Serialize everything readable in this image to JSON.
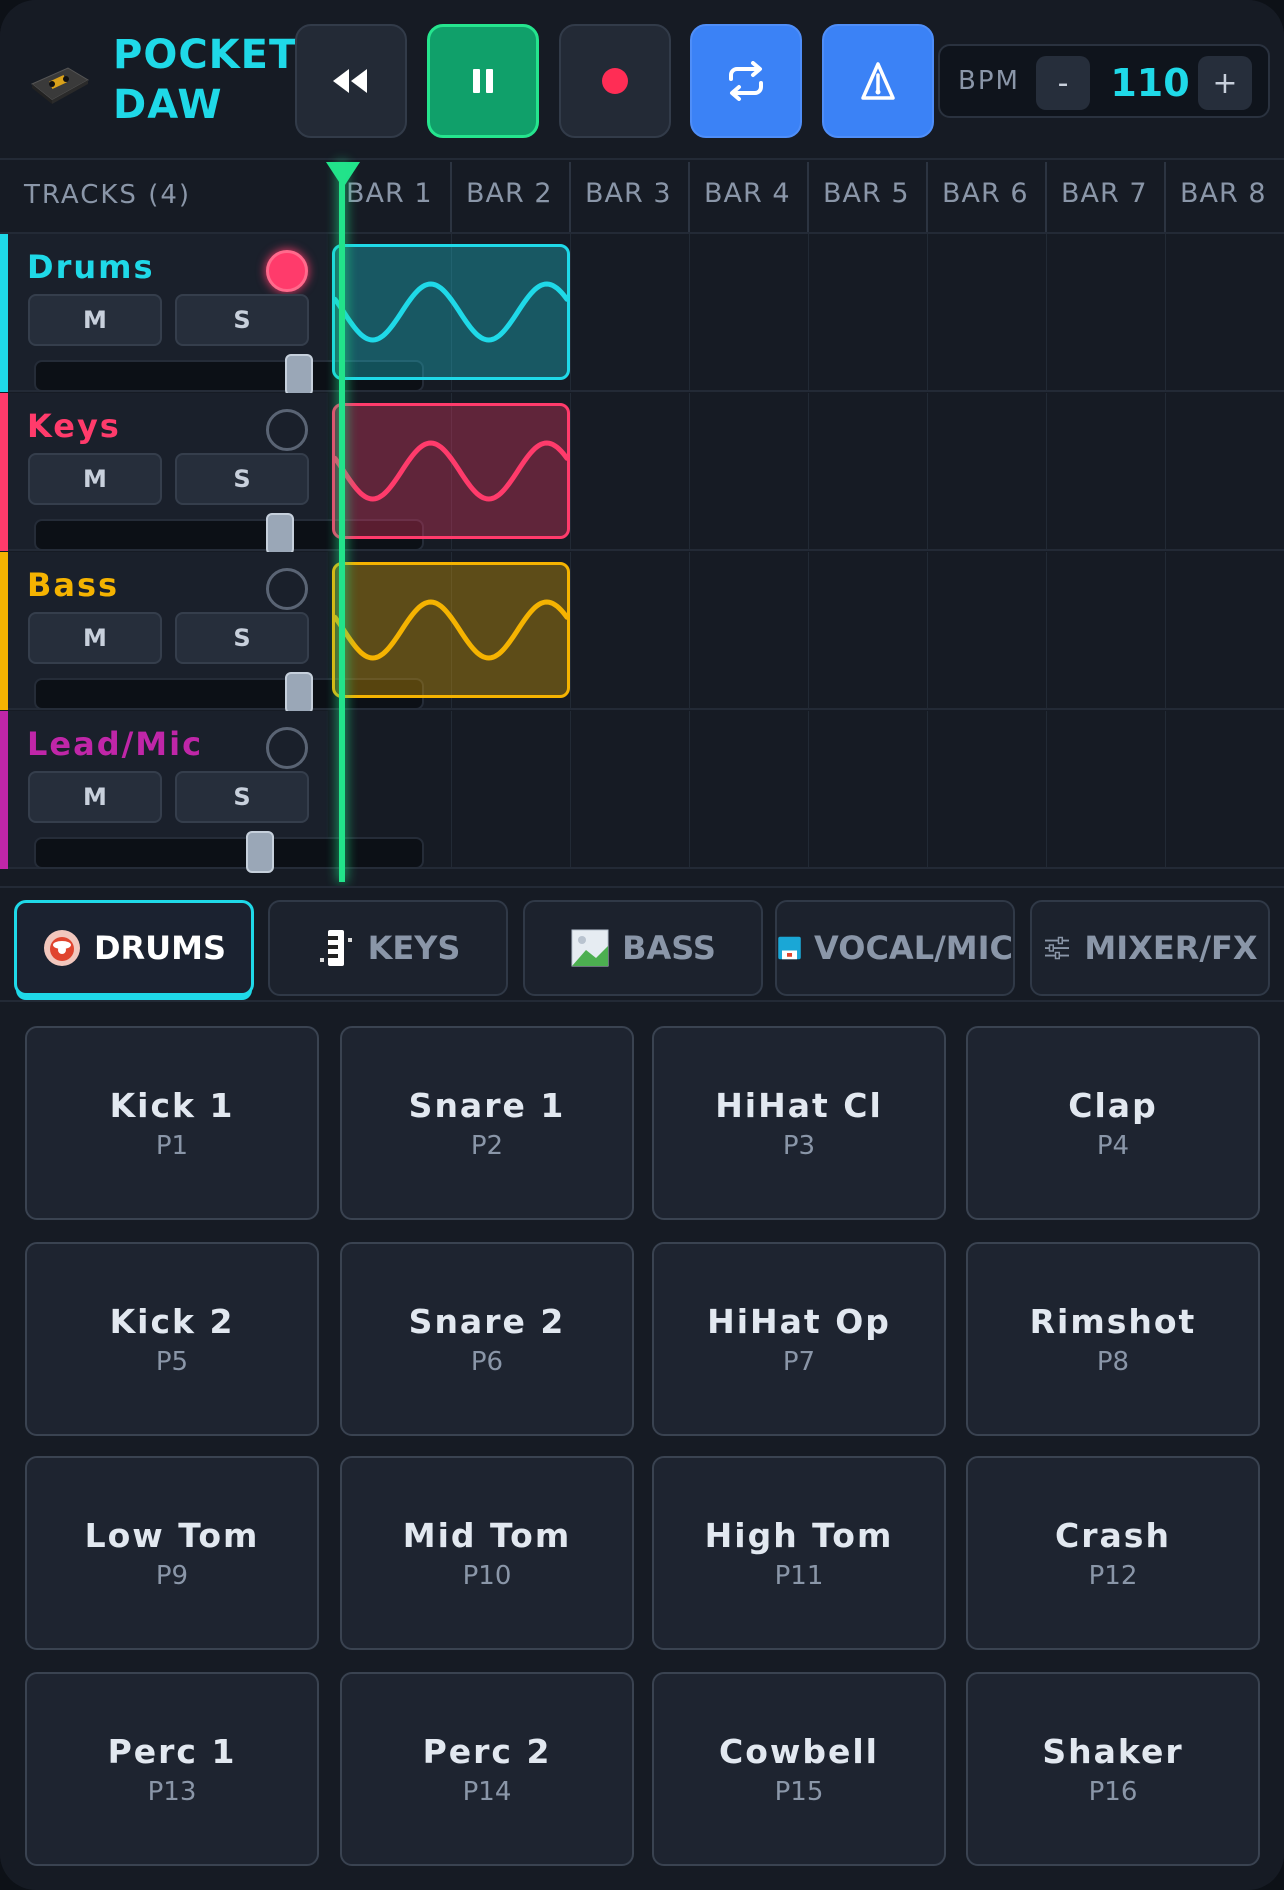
{
  "app": {
    "title_line1": "POCKET",
    "title_line2": "DAW"
  },
  "transport": {
    "rewind_icon": "rewind-icon",
    "pause_icon": "pause-icon",
    "record_icon": "record-icon",
    "loop_icon": "loop-icon",
    "metronome_icon": "metronome-icon"
  },
  "bpm": {
    "label": "BPM",
    "minus": "-",
    "value": "110",
    "plus": "+"
  },
  "timeline": {
    "tracks_title": "TRACKS (4)",
    "bars": [
      "BAR 1",
      "BAR 2",
      "BAR 3",
      "BAR 4",
      "BAR 5",
      "BAR 6",
      "BAR 7",
      "BAR 8"
    ]
  },
  "tracks": [
    {
      "name": "Drums",
      "color": "#1fd9e8",
      "mute": "M",
      "solo": "S",
      "armed": true,
      "volume": 0.68
    },
    {
      "name": "Keys",
      "color": "#ff3b6b",
      "mute": "M",
      "solo": "S",
      "armed": false,
      "volume": 0.63
    },
    {
      "name": "Bass",
      "color": "#f5b301",
      "mute": "M",
      "solo": "S",
      "armed": false,
      "volume": 0.68
    },
    {
      "name": "Lead/Mic",
      "color": "#c026a8",
      "mute": "M",
      "solo": "S",
      "armed": false,
      "volume": 0.58
    }
  ],
  "tabs": [
    {
      "label": "DRUMS",
      "icon": "drum-icon",
      "active": true
    },
    {
      "label": "KEYS",
      "icon": "keys-icon",
      "active": false
    },
    {
      "label": "BASS",
      "icon": "bass-icon",
      "active": false
    },
    {
      "label": "VOCAL/MIC",
      "icon": "mic-icon",
      "active": false
    },
    {
      "label": "MIXER/FX",
      "icon": "sliders-icon",
      "active": false
    }
  ],
  "pads": [
    {
      "name": "Kick 1",
      "num": "P1"
    },
    {
      "name": "Snare 1",
      "num": "P2"
    },
    {
      "name": "HiHat Cl",
      "num": "P3"
    },
    {
      "name": "Clap",
      "num": "P4"
    },
    {
      "name": "Kick 2",
      "num": "P5"
    },
    {
      "name": "Snare 2",
      "num": "P6"
    },
    {
      "name": "HiHat Op",
      "num": "P7"
    },
    {
      "name": "Rimshot",
      "num": "P8"
    },
    {
      "name": "Low Tom",
      "num": "P9"
    },
    {
      "name": "Mid Tom",
      "num": "P10"
    },
    {
      "name": "High Tom",
      "num": "P11"
    },
    {
      "name": "Crash",
      "num": "P12"
    },
    {
      "name": "Perc 1",
      "num": "P13"
    },
    {
      "name": "Perc 2",
      "num": "P14"
    },
    {
      "name": "Cowbell",
      "num": "P15"
    },
    {
      "name": "Shaker",
      "num": "P16"
    }
  ],
  "colors": {
    "accent": "#1fd9e8",
    "play": "#10a06a",
    "toggle_on": "#3b82f6",
    "playhead": "#22e38a"
  }
}
